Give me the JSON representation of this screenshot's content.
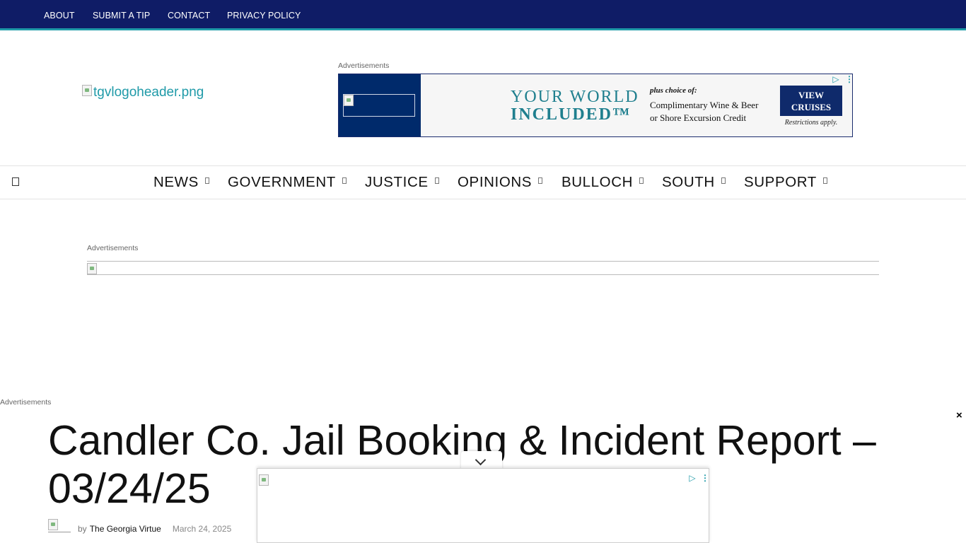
{
  "topbar": {
    "links": [
      "ABOUT",
      "SUBMIT A TIP",
      "CONTACT",
      "PRIVACY POLICY"
    ]
  },
  "header": {
    "logo_alt": "tgvlogoheader.png",
    "ad_label": "Advertisements"
  },
  "banner_ad": {
    "headline_line1": "YOUR WORLD",
    "headline_line2": "INCLUDED™",
    "plus_text": "plus choice of:",
    "offer_line1": "Complimentary Wine & Beer",
    "offer_line2": "or Shore Excursion Credit",
    "cta_line1": "VIEW",
    "cta_line2": "CRUISES",
    "restrictions": "Restrictions apply.",
    "adchoices_icon": "adchoices-triangle-icon",
    "brand_color": "#002a6b",
    "accent_color": "#1f7f8e"
  },
  "nav": {
    "menu_icon": "hamburger-menu-icon",
    "items": [
      "NEWS",
      "GOVERNMENT",
      "JUSTICE",
      "OPINIONS",
      "BULLOCH",
      "SOUTH",
      "SUPPORT"
    ]
  },
  "mid_ad": {
    "label": "Advertisements"
  },
  "side_ad": {
    "label": "Advertisements",
    "close": "×"
  },
  "article": {
    "title": "Candler Co. Jail Booking & Incident Report – 03/24/25",
    "by": "by",
    "author": "The Georgia Virtue",
    "date": "March 24, 2025"
  },
  "colors": {
    "topbar_bg": "#0f1c66",
    "topbar_border": "#1f9aa8",
    "link_color": "#1f9aa8"
  }
}
